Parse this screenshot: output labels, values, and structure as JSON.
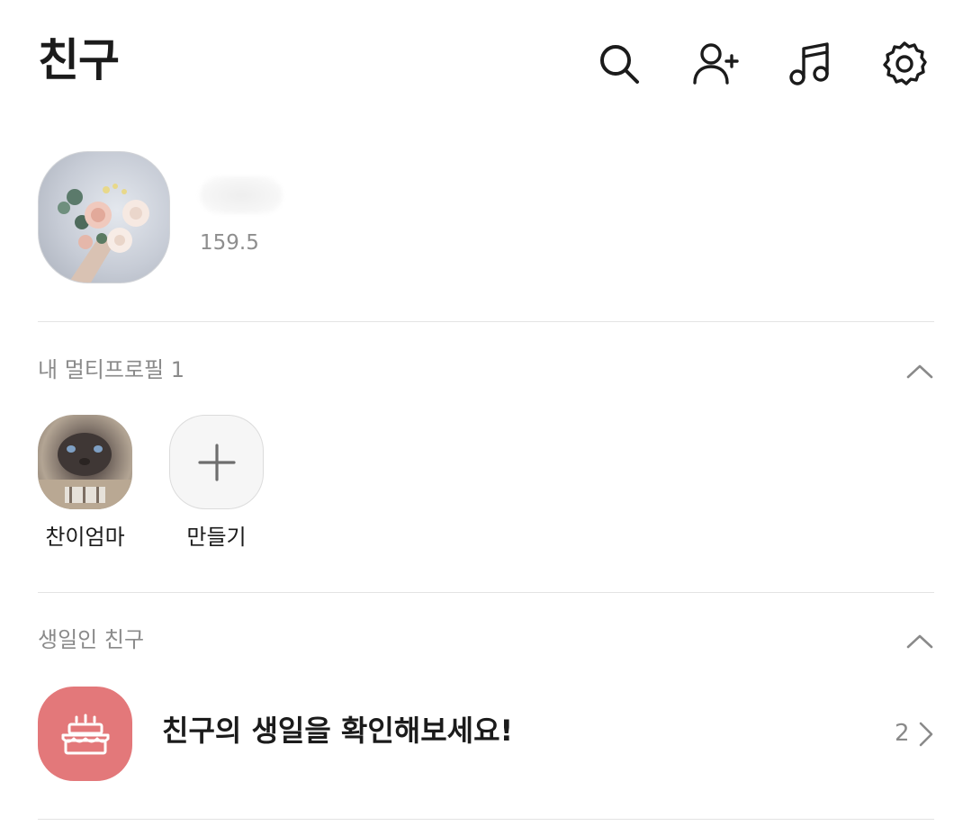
{
  "header": {
    "title": "친구",
    "icons": [
      "search-icon",
      "add-friend-icon",
      "music-icon",
      "settings-icon"
    ]
  },
  "my_profile": {
    "status": "159.5"
  },
  "multi_profile": {
    "section_title": "내 멀티프로필 1",
    "items": [
      {
        "label": "찬이엄마"
      },
      {
        "label": "만들기"
      }
    ]
  },
  "birthday": {
    "section_title": "생일인 친구",
    "message": "친구의 생일을 확인해보세요!",
    "count": "2",
    "accent_color": "#e3787a"
  }
}
